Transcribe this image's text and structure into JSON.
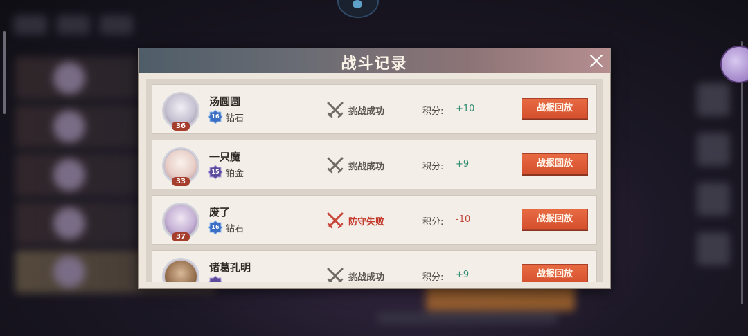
{
  "dialog": {
    "title": "战斗记录",
    "score_label": "积分:",
    "replay_label": "战报回放"
  },
  "records": [
    {
      "name": "汤圆圆",
      "level": "36",
      "rank_num": "16",
      "rank": "钻石",
      "result": "挑战成功",
      "score": "+10",
      "outcome": "win"
    },
    {
      "name": "一只魔",
      "level": "33",
      "rank_num": "15",
      "rank": "铂金",
      "result": "挑战成功",
      "score": "+9",
      "outcome": "win"
    },
    {
      "name": "废了",
      "level": "37",
      "rank_num": "16",
      "rank": "钻石",
      "result": "防守失败",
      "score": "-10",
      "outcome": "lose"
    },
    {
      "name": "诸葛孔明",
      "level": "",
      "rank_num": "",
      "rank": "",
      "result": "挑战成功",
      "score": "+9",
      "outcome": "win"
    }
  ],
  "colors": {
    "win_text": "#5a5550",
    "lose_text": "#c33a2c",
    "positive_score": "#2f8c72",
    "negative_score": "#c0483a",
    "replay_button": "#e0603a",
    "level_tag": "#a63e2e"
  }
}
